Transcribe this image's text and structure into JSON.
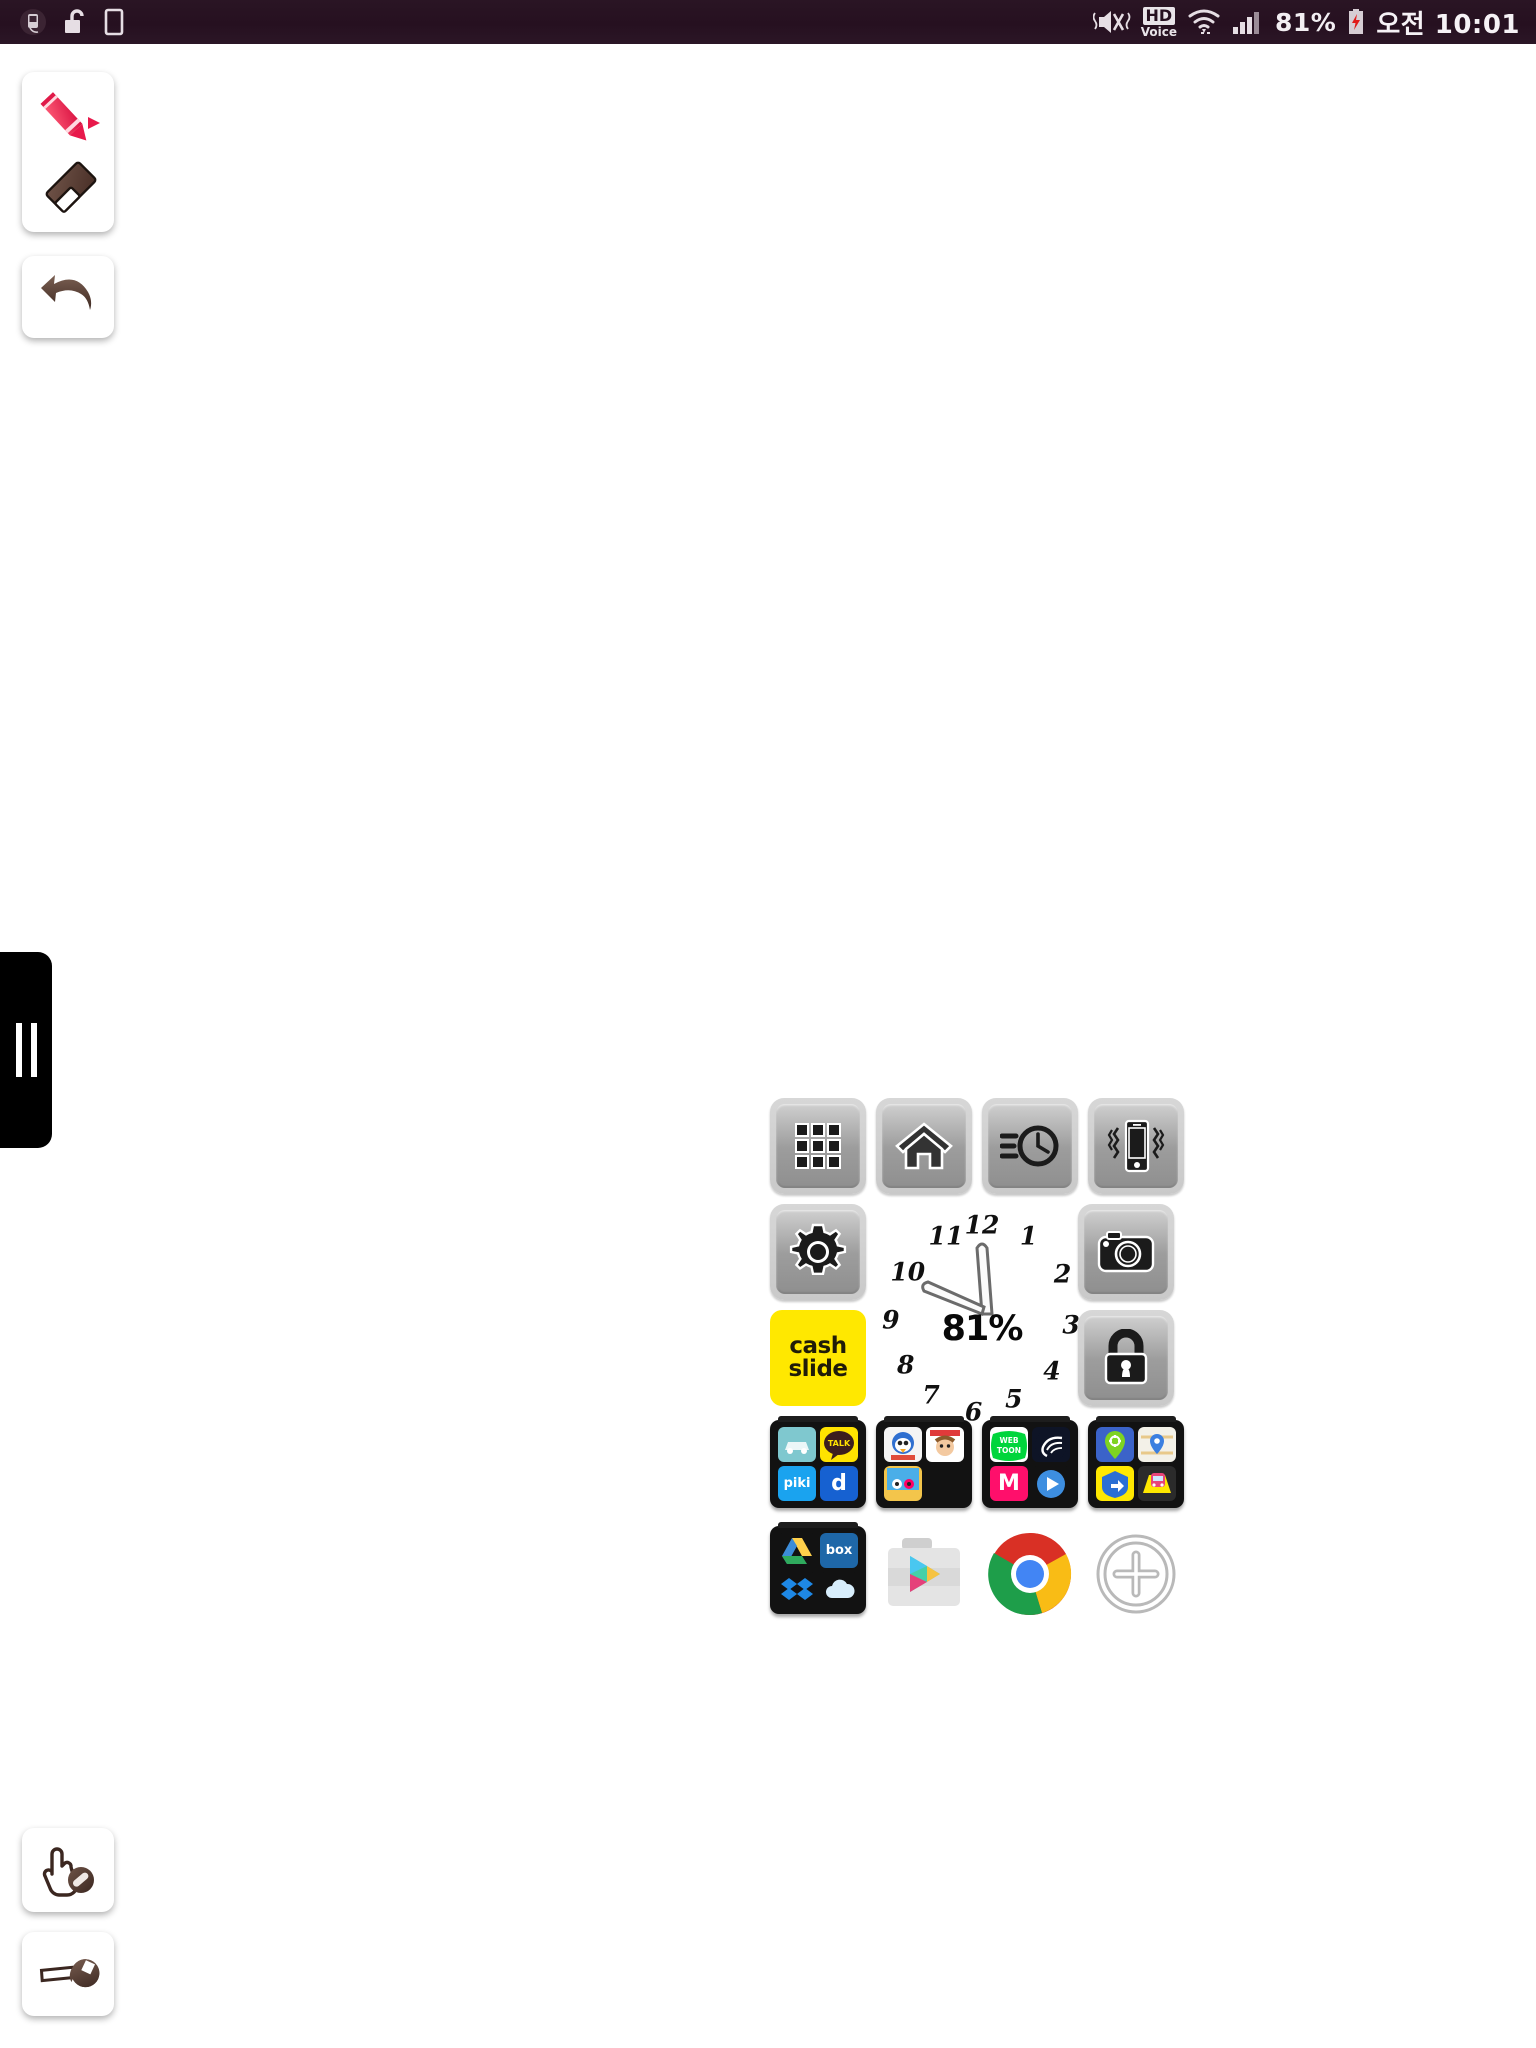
{
  "statusbar": {
    "left_icons": [
      "sdcard-icon",
      "unlock-icon",
      "sim-card-icon"
    ],
    "mute_icon": "vibrate-mute-icon",
    "hd_top": "HD",
    "hd_bottom": "Voice",
    "wifi_icon": "wifi-icon",
    "signal_icon": "cellular-signal-icon",
    "battery_percent": "81%",
    "battery_icon": "battery-charging-icon",
    "time": "오전 10:01"
  },
  "toolbar": {
    "pen_icon": "pencil-icon",
    "pen_expand_icon": "triangle-right-icon",
    "eraser_icon": "eraser-icon",
    "undo_icon": "undo-arrow-icon",
    "touch_lock_icon": "touch-block-icon",
    "settings_icon": "wrench-icon"
  },
  "drawer": {
    "handle_icon": "drawer-handle-icon"
  },
  "widget": {
    "row1": [
      {
        "name": "app-drawer-button",
        "icon": "apps-grid-icon"
      },
      {
        "name": "home-button",
        "icon": "home-icon"
      },
      {
        "name": "recent-clock-button",
        "icon": "speed-clock-icon"
      },
      {
        "name": "vibrate-button",
        "icon": "phone-vibrate-icon"
      }
    ],
    "row2": [
      {
        "name": "settings-button",
        "icon": "gear-icon"
      },
      {
        "name": "camera-button",
        "icon": "camera-icon"
      }
    ],
    "row3": [
      {
        "name": "cashslide-button",
        "line1": "cash",
        "line2": "slide",
        "color": "#ffe800"
      },
      {
        "name": "screen-lock-button",
        "icon": "padlock-icon"
      }
    ],
    "clock": {
      "numerals": [
        "1",
        "2",
        "3",
        "4",
        "5",
        "6",
        "7",
        "8",
        "9",
        "10",
        "11",
        "12"
      ],
      "center_label": "81%",
      "hour_hand_icon": "hour-hand-icon",
      "minute_hand_icon": "minute-hand-icon"
    },
    "folders": [
      {
        "name": "folder-messaging",
        "apps": [
          {
            "label": "",
            "icon": "kakao-drive-icon",
            "bg": "#7fc8cf",
            "fg": "#ffffff"
          },
          {
            "label": "TALK",
            "icon": "kakaotalk-icon",
            "bg": "#ffe300",
            "fg": "#3c1e1e"
          },
          {
            "label": "piki",
            "icon": "piki-icon",
            "bg": "#2196f3",
            "fg": "#ffffff"
          },
          {
            "label": "d",
            "icon": "daum-icon",
            "bg": "#1661d1",
            "fg": "#ffffff"
          }
        ]
      },
      {
        "name": "folder-kids",
        "apps": [
          {
            "label": "",
            "icon": "pororo-icon",
            "bg": "#f2f2f2",
            "fg": "#333333"
          },
          {
            "label": "",
            "icon": "kids-video-icon",
            "bg": "#ffffff",
            "fg": "#333333"
          },
          {
            "label": "",
            "icon": "kids-game-icon",
            "bg": "#f3c54b",
            "fg": "#333333"
          },
          {
            "label": "",
            "icon": "empty-slot",
            "bg": "#121212",
            "fg": "#121212"
          }
        ]
      },
      {
        "name": "folder-media",
        "apps": [
          {
            "label": "WEB TOON",
            "icon": "naver-webtoon-icon",
            "bg": "#ffffff",
            "fg": "#00c73c"
          },
          {
            "label": "",
            "icon": "dark-swirl-icon",
            "bg": "#0e1426",
            "fg": "#ffffff"
          },
          {
            "label": "M",
            "icon": "melon-icon",
            "bg": "#ff0f6b",
            "fg": "#ffffff"
          },
          {
            "label": "",
            "icon": "play-video-icon",
            "bg": "#3d8ee0",
            "fg": "#ffffff"
          }
        ]
      },
      {
        "name": "folder-navigation",
        "apps": [
          {
            "label": "",
            "icon": "map-pin-green-icon",
            "bg": "#3b63c9",
            "fg": "#7ed321"
          },
          {
            "label": "",
            "icon": "map-location-icon",
            "bg": "#f3f1e8",
            "fg": "#3b7fe0"
          },
          {
            "label": "",
            "icon": "navigation-arrow-icon",
            "bg": "#ffe800",
            "fg": "#2b6fd4"
          },
          {
            "label": "",
            "icon": "subway-icon",
            "bg": "#2b2b2b",
            "fg": "#ffe800"
          }
        ]
      },
      {
        "name": "folder-cloud",
        "apps": [
          {
            "label": "",
            "icon": "google-drive-icon",
            "bg": "#121212",
            "fg": "#ffffff"
          },
          {
            "label": "box",
            "icon": "box-icon",
            "bg": "#1e67a8",
            "fg": "#ffffff"
          },
          {
            "label": "",
            "icon": "dropbox-icon",
            "bg": "#121212",
            "fg": "#1e88e5"
          },
          {
            "label": "",
            "icon": "onedrive-icon",
            "bg": "#121212",
            "fg": "#d8eefc"
          }
        ]
      }
    ],
    "row5": [
      {
        "name": "play-store-button",
        "icon": "play-store-icon"
      },
      {
        "name": "chrome-button",
        "icon": "chrome-icon"
      },
      {
        "name": "add-item-button",
        "icon": "add-circle-icon"
      }
    ]
  }
}
